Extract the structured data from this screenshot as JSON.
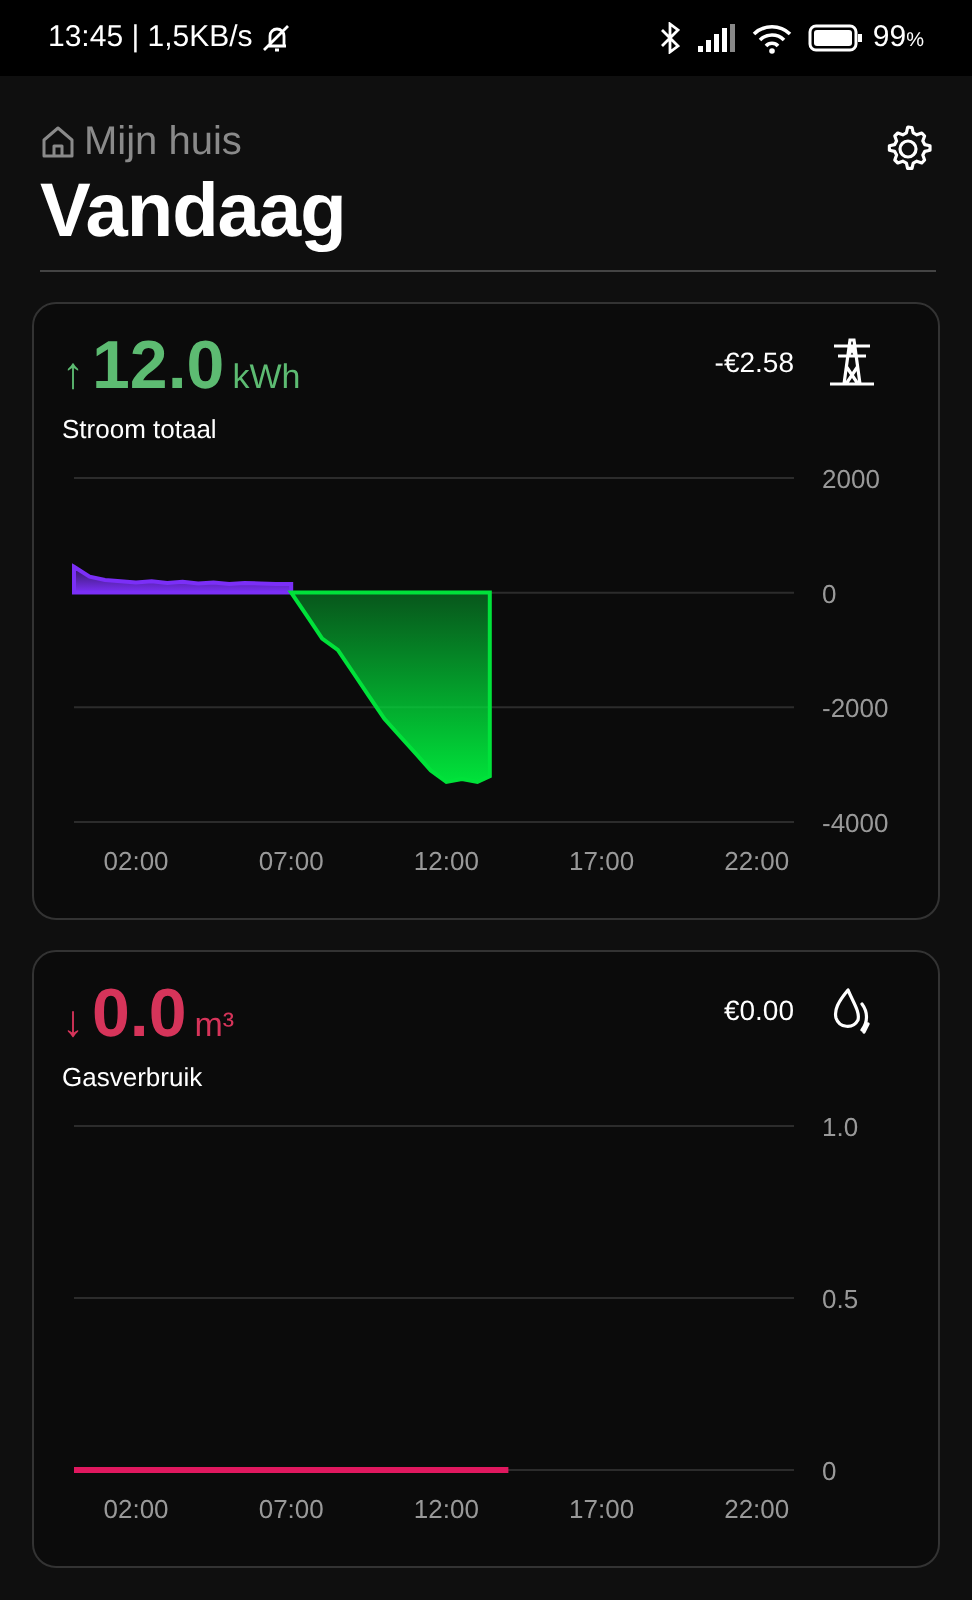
{
  "status_bar": {
    "time": "13:45 | 1,5KB/s",
    "battery": "99",
    "battery_unit": "%"
  },
  "header": {
    "breadcrumb": "Mijn huis",
    "title": "Vandaag"
  },
  "meters": [
    {
      "arrow": "↑",
      "value": "12.0",
      "unit": "kWh",
      "label": "Stroom totaal",
      "cost": "-€2.58",
      "kind": "power",
      "color": "#5dbb72",
      "chart_data": {
        "type": "area",
        "x": [
          0,
          0.5,
          1,
          1.5,
          2,
          2.5,
          3,
          3.5,
          4,
          4.5,
          5,
          5.5,
          6,
          6.5,
          7,
          7.5,
          8,
          8.5,
          9,
          9.5,
          10,
          10.5,
          11,
          11.5,
          12,
          12.5,
          13,
          13.4
        ],
        "series": [
          {
            "color": "#7b2ff7",
            "values": [
              450,
              280,
              220,
              200,
              180,
              200,
              170,
              190,
              160,
              180,
              150,
              170,
              160,
              150,
              150,
              null,
              null,
              null,
              null,
              null,
              null,
              null,
              null,
              null,
              null,
              null,
              null,
              null
            ]
          },
          {
            "color": "#00e23a",
            "values": [
              null,
              null,
              null,
              null,
              null,
              null,
              null,
              null,
              null,
              null,
              null,
              null,
              null,
              null,
              0,
              -400,
              -800,
              -1000,
              -1400,
              -1800,
              -2200,
              -2500,
              -2800,
              -3100,
              -3300,
              -3250,
              -3300,
              -3200
            ]
          }
        ],
        "xlim": [
          0,
          23.2
        ],
        "ylim": [
          -4000,
          2000
        ],
        "xticks": [
          {
            "value": 2,
            "label": "02:00"
          },
          {
            "value": 7,
            "label": "07:00"
          },
          {
            "value": 12,
            "label": "12:00"
          },
          {
            "value": 17,
            "label": "17:00"
          },
          {
            "value": 22,
            "label": "22:00"
          }
        ],
        "yticks": [
          2000,
          0,
          -2000,
          -4000
        ]
      }
    },
    {
      "arrow": "↓",
      "value": "0.0",
      "unit": "m³",
      "label": "Gasverbruik",
      "cost": "€0.00",
      "kind": "gas",
      "color": "#d6345a",
      "chart_data": {
        "type": "line",
        "x": [
          0,
          14
        ],
        "series": [
          {
            "color": "#e0185f",
            "values": [
              0,
              0
            ]
          }
        ],
        "xlim": [
          0,
          23.2
        ],
        "ylim": [
          0,
          1
        ],
        "xticks": [
          {
            "value": 2,
            "label": "02:00"
          },
          {
            "value": 7,
            "label": "07:00"
          },
          {
            "value": 12,
            "label": "12:00"
          },
          {
            "value": 17,
            "label": "17:00"
          },
          {
            "value": 22,
            "label": "22:00"
          }
        ],
        "yticks": [
          {
            "value": 1,
            "label": "1.0"
          },
          0.5,
          0
        ]
      }
    }
  ]
}
